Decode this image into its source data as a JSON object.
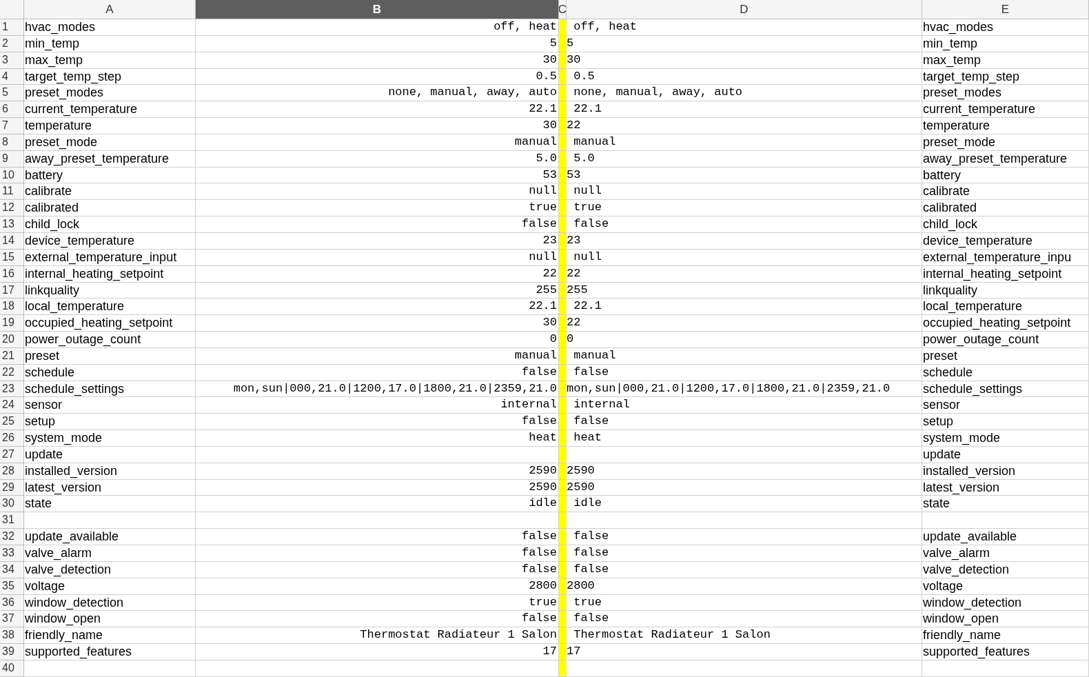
{
  "columns": [
    {
      "label": "A",
      "selected": false
    },
    {
      "label": "B",
      "selected": true
    },
    {
      "label": "C",
      "selected": false
    },
    {
      "label": "D",
      "selected": false
    },
    {
      "label": "E",
      "selected": false
    }
  ],
  "rows": [
    {
      "number": "1",
      "a": "hvac_modes",
      "b": "off, heat",
      "d": " off, heat",
      "e": "hvac_modes"
    },
    {
      "number": "2",
      "a": "min_temp",
      "b": "5",
      "d": "5",
      "e": "min_temp"
    },
    {
      "number": "3",
      "a": "max_temp",
      "b": "30",
      "d": "30",
      "e": "max_temp"
    },
    {
      "number": "4",
      "a": "target_temp_step",
      "b": "0.5",
      "d": " 0.5",
      "e": "target_temp_step"
    },
    {
      "number": "5",
      "a": "preset_modes",
      "b": "none, manual, away, auto",
      "d": " none, manual, away, auto",
      "e": "preset_modes"
    },
    {
      "number": "6",
      "a": "current_temperature",
      "b": "22.1",
      "d": " 22.1",
      "e": "current_temperature"
    },
    {
      "number": "7",
      "a": "temperature",
      "b": "30",
      "d": "22",
      "e": "temperature"
    },
    {
      "number": "8",
      "a": "preset_mode",
      "b": "manual",
      "d": " manual",
      "e": "preset_mode"
    },
    {
      "number": "9",
      "a": "away_preset_temperature",
      "b": "5.0",
      "d": " 5.0",
      "e": "away_preset_temperature"
    },
    {
      "number": "10",
      "a": "battery",
      "b": "53",
      "d": "53",
      "e": "battery"
    },
    {
      "number": "11",
      "a": "calibrate",
      "b": "null",
      "d": " null",
      "e": "calibrate"
    },
    {
      "number": "12",
      "a": "calibrated",
      "b": "true",
      "d": " true",
      "e": "calibrated"
    },
    {
      "number": "13",
      "a": "child_lock",
      "b": "false",
      "d": " false",
      "e": "child_lock"
    },
    {
      "number": "14",
      "a": "device_temperature",
      "b": "23",
      "d": "23",
      "e": "device_temperature"
    },
    {
      "number": "15",
      "a": "external_temperature_input",
      "b": "null",
      "d": " null",
      "e": "external_temperature_inpu"
    },
    {
      "number": "16",
      "a": "internal_heating_setpoint",
      "b": "22",
      "d": "22",
      "e": "internal_heating_setpoint"
    },
    {
      "number": "17",
      "a": "linkquality",
      "b": "255",
      "d": "255",
      "e": "linkquality"
    },
    {
      "number": "18",
      "a": "local_temperature",
      "b": "22.1",
      "d": " 22.1",
      "e": "local_temperature"
    },
    {
      "number": "19",
      "a": "occupied_heating_setpoint",
      "b": "30",
      "d": "22",
      "e": "occupied_heating_setpoint"
    },
    {
      "number": "20",
      "a": "power_outage_count",
      "b": "0",
      "d": "0",
      "e": "power_outage_count"
    },
    {
      "number": "21",
      "a": "preset",
      "b": "manual",
      "d": " manual",
      "e": "preset"
    },
    {
      "number": "22",
      "a": "schedule",
      "b": "false",
      "d": " false",
      "e": "schedule"
    },
    {
      "number": "23",
      "a": "schedule_settings",
      "b": "mon,sun|000,21.0|1200,17.0|1800,21.0|2359,21.0",
      "d": "mon,sun|000,21.0|1200,17.0|1800,21.0|2359,21.0",
      "e": "schedule_settings"
    },
    {
      "number": "24",
      "a": "sensor",
      "b": "internal",
      "d": " internal",
      "e": "sensor"
    },
    {
      "number": "25",
      "a": "setup",
      "b": "false",
      "d": " false",
      "e": "setup"
    },
    {
      "number": "26",
      "a": "system_mode",
      "b": "heat",
      "d": " heat",
      "e": "system_mode"
    },
    {
      "number": "27",
      "a": "update",
      "e": "update"
    },
    {
      "number": "28",
      "a": "installed_version",
      "b": "2590",
      "d": "2590",
      "e": "installed_version"
    },
    {
      "number": "29",
      "a": "latest_version",
      "b": "2590",
      "d": "2590",
      "e": "latest_version"
    },
    {
      "number": "30",
      "a": "state",
      "b": "idle",
      "d": " idle",
      "e": "state"
    },
    {
      "number": "31"
    },
    {
      "number": "32",
      "a": "update_available",
      "b": "false",
      "d": " false",
      "e": "update_available"
    },
    {
      "number": "33",
      "a": "valve_alarm",
      "b": "false",
      "d": " false",
      "e": "valve_alarm"
    },
    {
      "number": "34",
      "a": "valve_detection",
      "b": "false",
      "d": " false",
      "e": "valve_detection"
    },
    {
      "number": "35",
      "a": "voltage",
      "b": "2800",
      "d": "2800",
      "e": "voltage"
    },
    {
      "number": "36",
      "a": "window_detection",
      "b": "true",
      "d": " true",
      "e": "window_detection"
    },
    {
      "number": "37",
      "a": "window_open",
      "b": "false",
      "d": " false",
      "e": "window_open"
    },
    {
      "number": "38",
      "a": "friendly_name",
      "b": "Thermostat Radiateur 1 Salon",
      "d": " Thermostat Radiateur 1 Salon",
      "e": "friendly_name"
    },
    {
      "number": "39",
      "a": "supported_features",
      "b": "17",
      "d": "17",
      "e": "supported_features"
    },
    {
      "number": "40"
    }
  ]
}
